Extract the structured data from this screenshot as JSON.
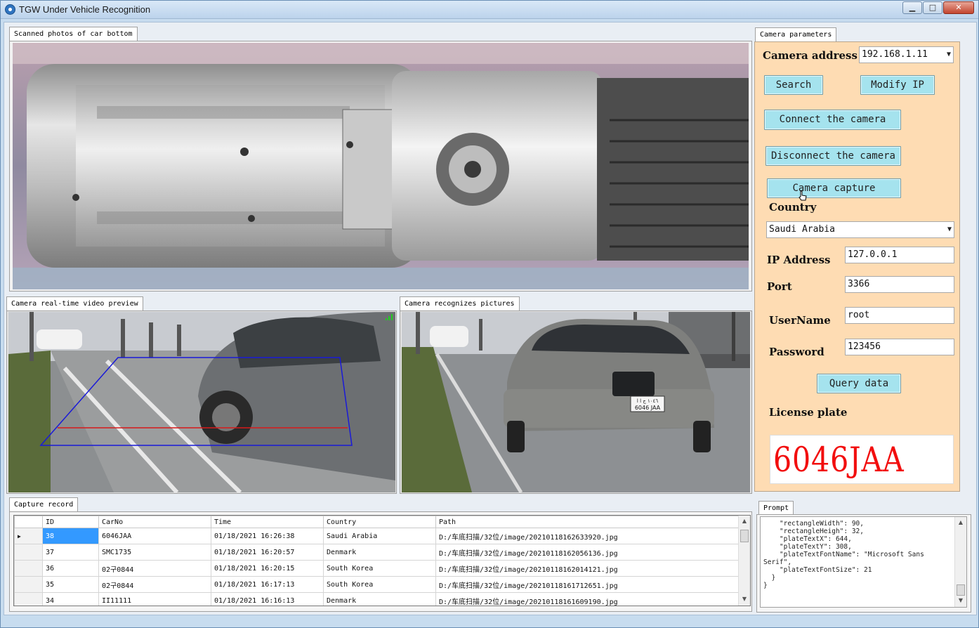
{
  "window": {
    "title": "TGW Under Vehicle Recognition",
    "minimize_glyph": "▁",
    "maximize_glyph": "□",
    "close_glyph": "✕"
  },
  "panels": {
    "scan_title": "Scanned photos of car bottom",
    "preview_title": "Camera real-time video preview",
    "recognize_title": "Camera recognizes pictures",
    "params_title": "Camera parameters",
    "record_title": "Capture record",
    "prompt_title": "Prompt"
  },
  "camera": {
    "address_label": "Camera address",
    "address_value": "192.168.1.11",
    "search_label": "Search",
    "modify_ip_label": "Modify IP",
    "connect_label": "Connect the camera",
    "disconnect_label": "Disconnect the camera",
    "capture_label": "Camera capture",
    "country_label": "Country",
    "country_value": "Saudi Arabia",
    "ip_label": "IP Address",
    "ip_value": "127.0.0.1",
    "port_label": "Port",
    "port_value": "3366",
    "username_label": "UserName",
    "username_value": "root",
    "password_label": "Password",
    "password_value": "123456",
    "query_label": "Query data",
    "plate_label": "License plate",
    "plate_value": "6046JAA"
  },
  "recognized_plate_sign": {
    "line1": "١٠٤٦ ج ا ا",
    "line2": "6046 JAA"
  },
  "records": {
    "columns": [
      "ID",
      "CarNo",
      "Time",
      "Country",
      "Path"
    ],
    "rows": [
      {
        "id": "38",
        "car": "6046JAA",
        "time": "01/18/2021 16:26:38",
        "country": "Saudi Arabia",
        "path": "D:/车底扫描/32位/image/20210118162633920.jpg"
      },
      {
        "id": "37",
        "car": "SMC1735",
        "time": "01/18/2021 16:20:57",
        "country": "Denmark",
        "path": "D:/车底扫描/32位/image/20210118162056136.jpg"
      },
      {
        "id": "36",
        "car": "02구0844",
        "time": "01/18/2021 16:20:15",
        "country": "South Korea",
        "path": "D:/车底扫描/32位/image/20210118162014121.jpg"
      },
      {
        "id": "35",
        "car": "02구0844",
        "time": "01/18/2021 16:17:13",
        "country": "South Korea",
        "path": "D:/车底扫描/32位/image/20210118161712651.jpg"
      },
      {
        "id": "34",
        "car": "II11111",
        "time": "01/18/2021 16:16:13",
        "country": "Denmark",
        "path": "D:/车底扫描/32位/image/20210118161609190.jpg"
      }
    ]
  },
  "prompt": {
    "text": "    \"rectangleWidth\": 90,\n    \"rectangleHeigh\": 32,\n    \"plateTextX\": 644,\n    \"plateTextY\": 308,\n    \"plateTextFontName\": \"Microsoft Sans Serif\",\n    \"plateTextFontSize\": 21\n  }\n}"
  },
  "colors": {
    "button_fill": "#a5e3ee",
    "params_bg": "#fedcb3",
    "plate_red": "#f20e0e",
    "selected_row": "#3399ff"
  },
  "icons": {
    "row_pointer": "▶",
    "dropdown": "▼",
    "scroll_up": "▲",
    "scroll_down": "▼"
  }
}
